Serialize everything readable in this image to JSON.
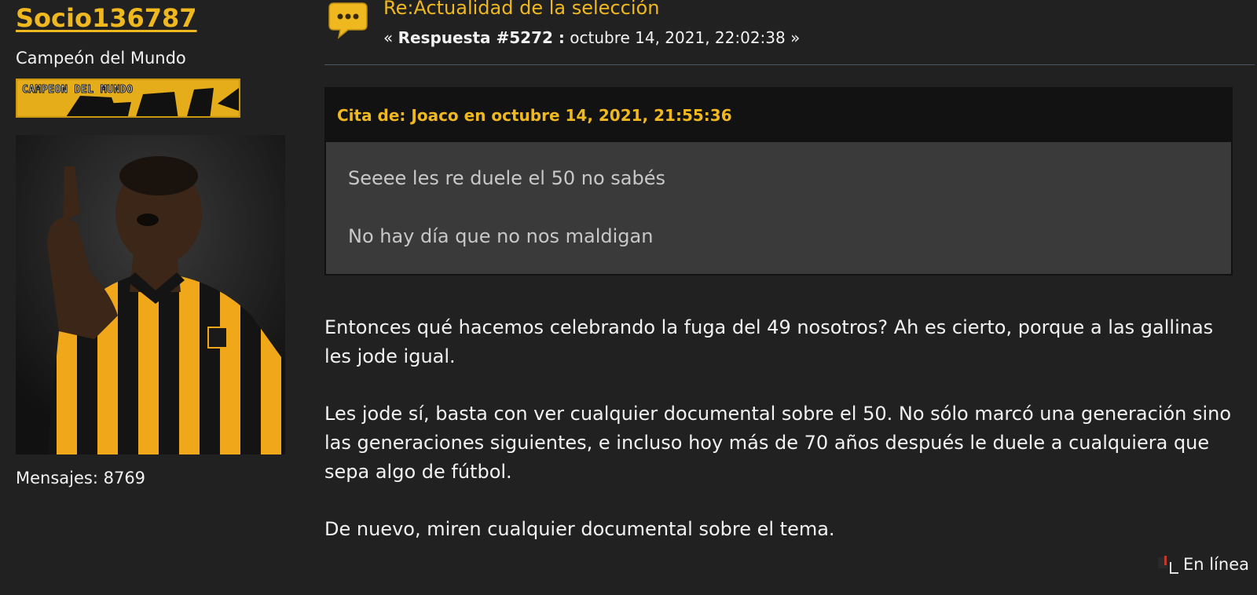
{
  "poster": {
    "username": "Socio136787",
    "rank": "Campeón del Mundo",
    "badge_text": "CAMPEON DEL MUNDO",
    "post_count_label": "Mensajes: 8769"
  },
  "post": {
    "title": "Re:Actualidad de la selección",
    "meta_prefix": "« ",
    "reply_label": "Respuesta #5272 :",
    "date": " octubre 14, 2021, 22:02:38 »",
    "quote": {
      "header": "Cita de: Joaco en octubre 14, 2021, 21:55:36",
      "lines": [
        "Seeee les re duele el 50 no sabés",
        "No hay día que no nos maldigan"
      ]
    },
    "paragraphs": [
      "Entonces qué hacemos celebrando la fuga del 49 nosotros? Ah es cierto, porque a las gallinas les jode igual.",
      "Les jode sí, basta con ver cualquier documental sobre el 50. No sólo marcó una generación sino las generaciones siguientes, e incluso hoy más de 70 años después le duele a cualquiera que sepa algo de fútbol.",
      "De nuevo, miren cualquier documental sobre el tema."
    ],
    "status": "En línea"
  },
  "colors": {
    "background": "#212121",
    "accent": "#f0b81f",
    "quote_header_bg": "#121212",
    "quote_body_bg": "#3a3a3a"
  },
  "icons": {
    "post_icon": "speech-bubble-icon",
    "status_icon": "online-status-icon"
  }
}
